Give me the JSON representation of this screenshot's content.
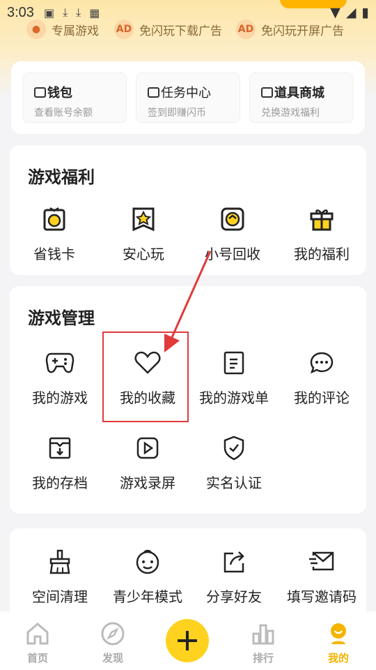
{
  "status": {
    "time": "3:03"
  },
  "benefits": [
    {
      "label": "专属游戏"
    },
    {
      "label": "免闪玩下载广告"
    },
    {
      "label": "免闪玩开屏广告"
    }
  ],
  "wallet": [
    {
      "title": "钱包",
      "sub": "查看账号余额"
    },
    {
      "title": "任务中心",
      "sub": "签到即赚闪币"
    },
    {
      "title": "道具商城",
      "sub": "兑换游戏福利"
    }
  ],
  "welfare": {
    "title": "游戏福利",
    "items": [
      {
        "label": "省钱卡",
        "icon": "money-card-icon"
      },
      {
        "label": "安心玩",
        "icon": "star-badge-icon"
      },
      {
        "label": "小号回收",
        "icon": "recycle-icon"
      },
      {
        "label": "我的福利",
        "icon": "gift-icon"
      }
    ]
  },
  "management": {
    "title": "游戏管理",
    "items": [
      {
        "label": "我的游戏",
        "icon": "gamepad-icon"
      },
      {
        "label": "我的收藏",
        "icon": "heart-icon"
      },
      {
        "label": "我的游戏单",
        "icon": "list-doc-icon"
      },
      {
        "label": "我的评论",
        "icon": "comment-icon"
      },
      {
        "label": "我的存档",
        "icon": "save-archive-icon"
      },
      {
        "label": "游戏录屏",
        "icon": "video-play-icon"
      },
      {
        "label": "实名认证",
        "icon": "shield-check-icon"
      }
    ]
  },
  "tools": {
    "items": [
      {
        "label": "空间清理",
        "icon": "broom-icon"
      },
      {
        "label": "青少年模式",
        "icon": "child-face-icon"
      },
      {
        "label": "分享好友",
        "icon": "share-icon"
      },
      {
        "label": "填写邀请码",
        "icon": "invite-mail-icon"
      }
    ]
  },
  "tabbar": {
    "tabs": [
      {
        "label": "首页",
        "icon": "home-icon"
      },
      {
        "label": "发现",
        "icon": "compass-icon"
      },
      {
        "label": "排行",
        "icon": "ranking-icon"
      },
      {
        "label": "我的",
        "icon": "profile-icon"
      }
    ],
    "active": "我的"
  },
  "colors": {
    "accent": "#ffd21f",
    "active_tab": "#f5b400",
    "highlight": "#e03a3a"
  }
}
